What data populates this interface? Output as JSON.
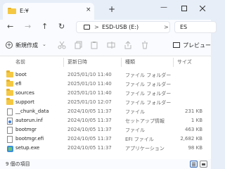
{
  "window": {
    "tab_title": "E:¥",
    "tab_close": "×",
    "new_tab": "+",
    "minimize": "—"
  },
  "nav": {
    "back": "←",
    "forward": "→",
    "up": "↑",
    "refresh": "↻",
    "address_chevron": ">",
    "address_path": "ESD-USB (E:)",
    "address_after": ">",
    "search_text": "ES"
  },
  "commandbar": {
    "new_label": "新規作成",
    "new_dropdown": "⌄",
    "preview_label": "プレビュー"
  },
  "columns": {
    "name": "名前",
    "date": "更新日時",
    "type": "種類",
    "size": "サイズ"
  },
  "files": [
    {
      "name": "boot",
      "date": "2025/01/10 11:40",
      "type": "ファイル フォルダー",
      "size": "",
      "icon": "folder-icon"
    },
    {
      "name": "efi",
      "date": "2025/01/10 11:40",
      "type": "ファイル フォルダー",
      "size": "",
      "icon": "folder-icon"
    },
    {
      "name": "sources",
      "date": "2025/01/10 11:40",
      "type": "ファイル フォルダー",
      "size": "",
      "icon": "folder-icon"
    },
    {
      "name": "support",
      "date": "2025/01/10 12:07",
      "type": "ファイル フォルダー",
      "size": "",
      "icon": "folder-icon"
    },
    {
      "name": "__chunk_data",
      "date": "2024/10/05 11:37",
      "type": "ファイル",
      "size": "231 KB",
      "icon": "file-icon"
    },
    {
      "name": "autorun.inf",
      "date": "2024/10/05 11:37",
      "type": "セットアップ情報",
      "size": "1 KB",
      "icon": "settings-file-icon"
    },
    {
      "name": "bootmgr",
      "date": "2024/10/05 11:37",
      "type": "ファイル",
      "size": "463 KB",
      "icon": "file-icon"
    },
    {
      "name": "bootmgr.efi",
      "date": "2024/10/05 11:37",
      "type": "EFI ファイル",
      "size": "2,682 KB",
      "icon": "file-icon"
    },
    {
      "name": "setup.exe",
      "date": "2024/10/05 11:37",
      "type": "アプリケーション",
      "size": "98 KB",
      "icon": "app-icon"
    }
  ],
  "status": {
    "item_count": "9 個の項目"
  },
  "colors": {
    "accent": "#3d6db5",
    "folder": "#f5c843",
    "chrome": "#e7eef8"
  }
}
